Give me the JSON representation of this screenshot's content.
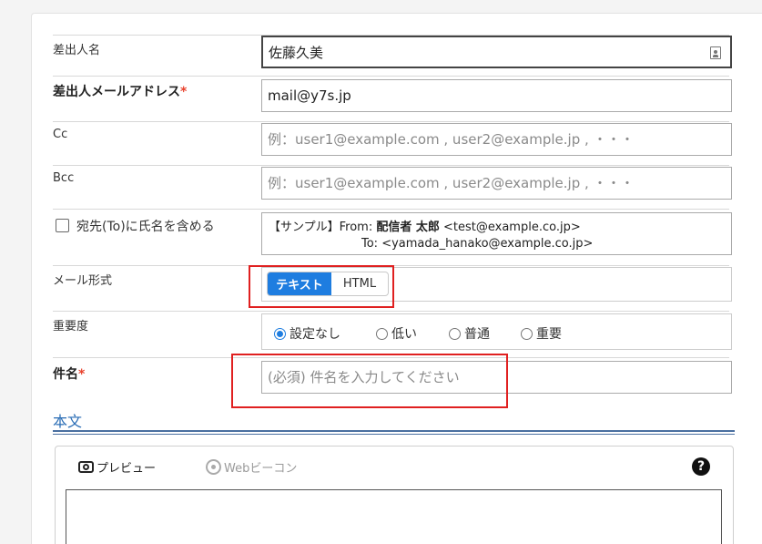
{
  "sender": {
    "name_label": "差出人名",
    "name_value": "佐藤久美",
    "email_label": "差出人メールアドレス",
    "email_value": "mail@y7s.jp",
    "required_mark": "*"
  },
  "cc": {
    "label": "Cc",
    "placeholder": "例：user1@example.com , user2@example.jp , ・・・"
  },
  "bcc": {
    "label": "Bcc",
    "placeholder": "例：user1@example.com , user2@example.jp , ・・・"
  },
  "include_name": {
    "label": "宛先(To)に氏名を含める",
    "sample_prefix": "【サンプル】From: ",
    "sample_from_name": "配信者 太郎",
    "sample_from_addr": " <test@example.co.jp>",
    "sample_to": "To: <yamada_hanako@example.co.jp>"
  },
  "mail_format": {
    "label": "メール形式",
    "options": [
      "テキスト",
      "HTML"
    ],
    "selected": "テキスト"
  },
  "priority": {
    "label": "重要度",
    "options": [
      "設定なし",
      "低い",
      "普通",
      "重要"
    ],
    "selected": "設定なし"
  },
  "subject": {
    "label": "件名",
    "placeholder": "(必須) 件名を入力してください"
  },
  "body": {
    "section_title": "本文",
    "preview_label": "プレビュー",
    "beacon_label": "Webビーコン",
    "help_label": "?"
  },
  "colors": {
    "accent": "#1e7de0",
    "required": "#e8412c",
    "highlight": "#e02020",
    "section": "#2a6db5"
  }
}
